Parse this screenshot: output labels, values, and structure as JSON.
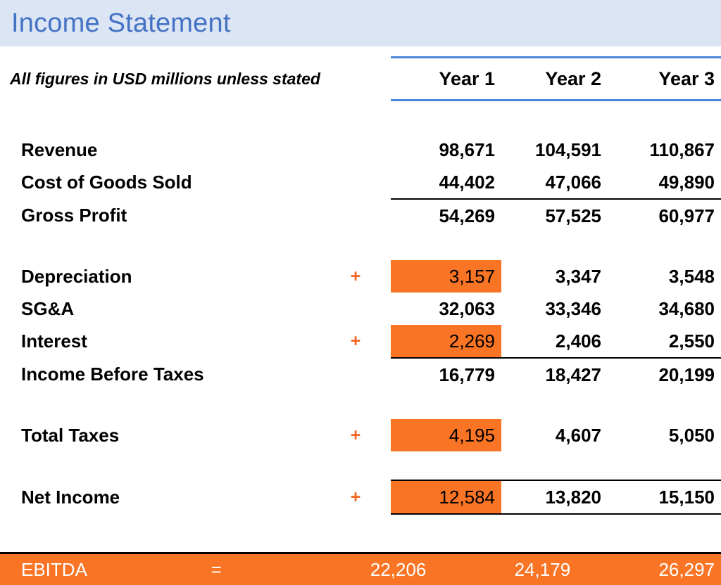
{
  "header": {
    "title": "Income Statement",
    "note": "All figures in USD millions unless stated",
    "columns": [
      "Year 1",
      "Year 2",
      "Year 3"
    ]
  },
  "colors": {
    "title_band": "#dbe5f4",
    "title_text": "#4472c4",
    "header_rule": "#4a86d8",
    "highlight": "#f97424",
    "operator": "#f26522",
    "footer_bar": "#f97424",
    "footer_text": "#ffffff"
  },
  "rows": [
    {
      "label": "Revenue",
      "op": "",
      "values": [
        "98,671",
        "104,591",
        "110,867"
      ],
      "highlight": false,
      "rule_above": false,
      "rule_below": false
    },
    {
      "label": "Cost of Goods Sold",
      "op": "",
      "values": [
        "44,402",
        "47,066",
        "49,890"
      ],
      "highlight": false,
      "rule_above": false,
      "rule_below": false
    },
    {
      "label": "Gross Profit",
      "op": "",
      "values": [
        "54,269",
        "57,525",
        "60,977"
      ],
      "highlight": false,
      "rule_above": true,
      "rule_below": false
    },
    {
      "label": "Depreciation",
      "op": "+",
      "values": [
        "3,157",
        "3,347",
        "3,548"
      ],
      "highlight": true,
      "rule_above": false,
      "rule_below": false
    },
    {
      "label": "SG&A",
      "op": "",
      "values": [
        "32,063",
        "33,346",
        "34,680"
      ],
      "highlight": false,
      "rule_above": false,
      "rule_below": false
    },
    {
      "label": "Interest",
      "op": "+",
      "values": [
        "2,269",
        "2,406",
        "2,550"
      ],
      "highlight": true,
      "rule_above": false,
      "rule_below": false
    },
    {
      "label": "Income Before Taxes",
      "op": "",
      "values": [
        "16,779",
        "18,427",
        "20,199"
      ],
      "highlight": false,
      "rule_above": true,
      "rule_below": false
    },
    {
      "label": "Total Taxes",
      "op": "+",
      "values": [
        "4,195",
        "4,607",
        "5,050"
      ],
      "highlight": true,
      "rule_above": false,
      "rule_below": false
    },
    {
      "label": "Net Income",
      "op": "+",
      "values": [
        "12,584",
        "13,820",
        "15,150"
      ],
      "highlight": true,
      "rule_above": true,
      "rule_below": true
    }
  ],
  "footer": {
    "label": "EBITDA",
    "op": "=",
    "values": [
      "22,206",
      "24,179",
      "26,297"
    ]
  }
}
